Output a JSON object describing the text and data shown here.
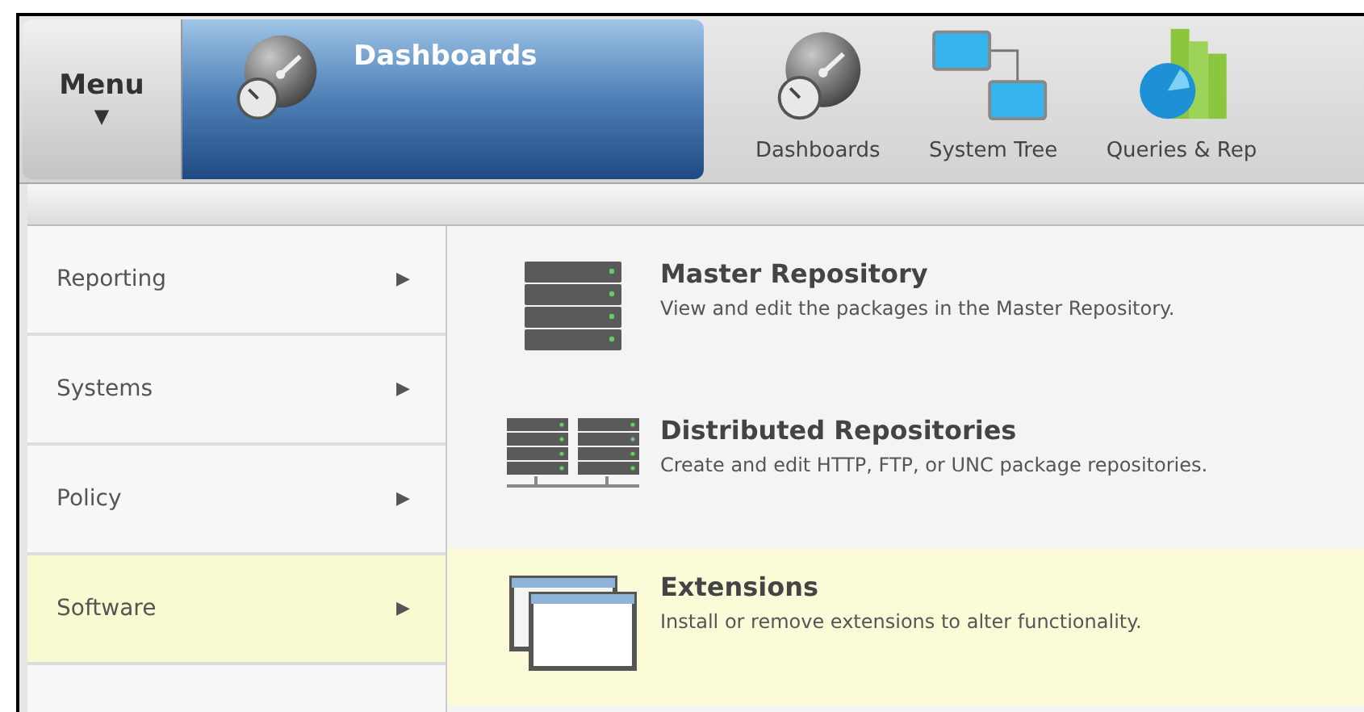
{
  "menu_button": {
    "label": "Menu",
    "arrow": "▼"
  },
  "current_section": {
    "title": "Dashboards"
  },
  "shortcuts": [
    {
      "label": "Dashboards",
      "kind": "gauge"
    },
    {
      "label": "System Tree",
      "kind": "tree"
    },
    {
      "label": "Queries & Rep",
      "kind": "chart"
    }
  ],
  "menu_items": [
    {
      "label": "Reporting",
      "arrow": "▶",
      "selected": false
    },
    {
      "label": "Systems",
      "arrow": "▶",
      "selected": false
    },
    {
      "label": "Policy",
      "arrow": "▶",
      "selected": false
    },
    {
      "label": "Software",
      "arrow": "▶",
      "selected": true
    }
  ],
  "submenu_items": [
    {
      "title": "Master Repository",
      "description": "View and edit the packages in the Master Repository.",
      "kind": "server",
      "selected": false
    },
    {
      "title": "Distributed Repositories",
      "description": "Create and edit HTTP, FTP, or UNC package repositories.",
      "kind": "servers",
      "selected": false
    },
    {
      "title": "Extensions",
      "description": "Install or remove extensions to alter functionality.",
      "kind": "windows",
      "selected": true
    }
  ]
}
